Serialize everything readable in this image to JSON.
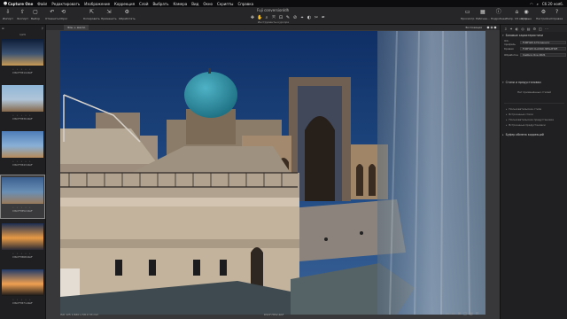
{
  "menubar": {
    "apple": "",
    "items": [
      "Capture One",
      "Файл",
      "Редактировать",
      "Изображение",
      "Коррекция",
      "Слой",
      "Выбрать",
      "Камера",
      "Вид",
      "Окно",
      "Скрипты",
      "Справка"
    ],
    "clock": "Сб 20 нояб."
  },
  "toolbar": {
    "left_buttons": [
      {
        "label": "Импорт",
        "icon": "import-icon",
        "glyph": "⇩"
      },
      {
        "label": "Экспорт",
        "icon": "export-icon",
        "glyph": "⇧"
      },
      {
        "label": "Выбор",
        "icon": "select-icon",
        "glyph": "▢"
      },
      {
        "label": "Отменить",
        "icon": "undo-icon",
        "glyph": "↶"
      },
      {
        "label": "Сброс",
        "icon": "reset-icon",
        "glyph": "⟲"
      }
    ],
    "mid_buttons": [
      {
        "label": "Копировать",
        "icon": "copy-icon",
        "glyph": "⇱"
      },
      {
        "label": "Применить",
        "icon": "apply-icon",
        "glyph": "⇲"
      },
      {
        "label": "Обработать",
        "icon": "process-icon",
        "glyph": "⚙"
      }
    ],
    "doc_title": "Fuji conversionIdh",
    "cursor_tools_label": "Инструменты курсора",
    "cursor_tools": [
      "✥",
      "✋",
      "⌕",
      "⤧",
      "⊡",
      "✎",
      "⊘",
      "⌖",
      "◐",
      "✂",
      "✒"
    ],
    "right_buttons": [
      {
        "label": "Просмотр",
        "icon": "viewer-icon",
        "glyph": "▭"
      },
      {
        "label": "Рабочее...",
        "icon": "grid-icon",
        "glyph": "▦"
      },
      {
        "label": "Подробнее",
        "icon": "info-icon",
        "glyph": "ⓘ"
      },
      {
        "label": "Напр. 18 инстр.",
        "icon": "workspace-icon",
        "glyph": "⌂"
      },
      {
        "label": "Кривые",
        "icon": "curves-icon",
        "glyph": "◉"
      },
      {
        "label": "Настройки",
        "icon": "settings-icon",
        "glyph": "⚙"
      },
      {
        "label": "Справка",
        "icon": "help-icon",
        "glyph": "?"
      }
    ]
  },
  "browser": {
    "header_left": "⊞",
    "header_right": "⚲",
    "count": "1/23",
    "thumbs": [
      {
        "name": "DSCF7814.RAF",
        "colors": [
          "#0d1d38",
          "#3c5372",
          "#c99a55"
        ],
        "selected": false
      },
      {
        "name": "DSCF7830.RAF",
        "colors": [
          "#8fb6d8",
          "#b0c5d8",
          "#85684a"
        ],
        "selected": false
      },
      {
        "name": "DSCF7843.RAF",
        "colors": [
          "#4e7db8",
          "#89b0d6",
          "#b58a5a"
        ],
        "selected": false
      },
      {
        "name": "DSCF7852.RAF",
        "colors": [
          "#3a5f8f",
          "#6a8fb5",
          "#9a7a5a"
        ],
        "selected": true
      },
      {
        "name": "DSCF7868.RAF",
        "colors": [
          "#1a2d52",
          "#e89a45",
          "#2a2a35"
        ],
        "selected": false
      },
      {
        "name": "DSCF7871.RAF",
        "colors": [
          "#203a6a",
          "#f0a050",
          "#151518"
        ],
        "selected": false
      }
    ]
  },
  "viewer": {
    "tab": "Фон + масло",
    "exposure_label": "Экспозиция",
    "status_left": "ISO 125   1/640 s   f/8.0   33 mm",
    "caption": "DSCF7852.RAF",
    "status_icons": [
      "▭",
      "▭",
      "⊞",
      "□",
      "▤",
      "⊡"
    ]
  },
  "inspector": {
    "tabs": [
      "⇩",
      "✦",
      "◐",
      "◎",
      "▤",
      "⚙",
      "◫",
      "⋯"
    ],
    "basic_title": "Базовые характеристики",
    "basic_fields": [
      {
        "key": "ICC-профиль",
        "value": "FUJIFILM X-T4 Generic"
      },
      {
        "key": "Кривая",
        "value": "FUJIFILM CLASSIC NEGATIVE"
      },
      {
        "key": "Обработка",
        "value": "Capture One 2021"
      }
    ],
    "styles_title": "Стили и предустановки",
    "none_applied": "Нет применённых стилей",
    "sub_items": [
      "Пользовательские стили",
      "Встроенные стили",
      "Пользовательские предустановки",
      "Встроенные предустановки"
    ],
    "buffer_title": "Буфер обмена коррекций"
  },
  "colors": {
    "accent": "#c9a24a",
    "panel": "#202022"
  }
}
